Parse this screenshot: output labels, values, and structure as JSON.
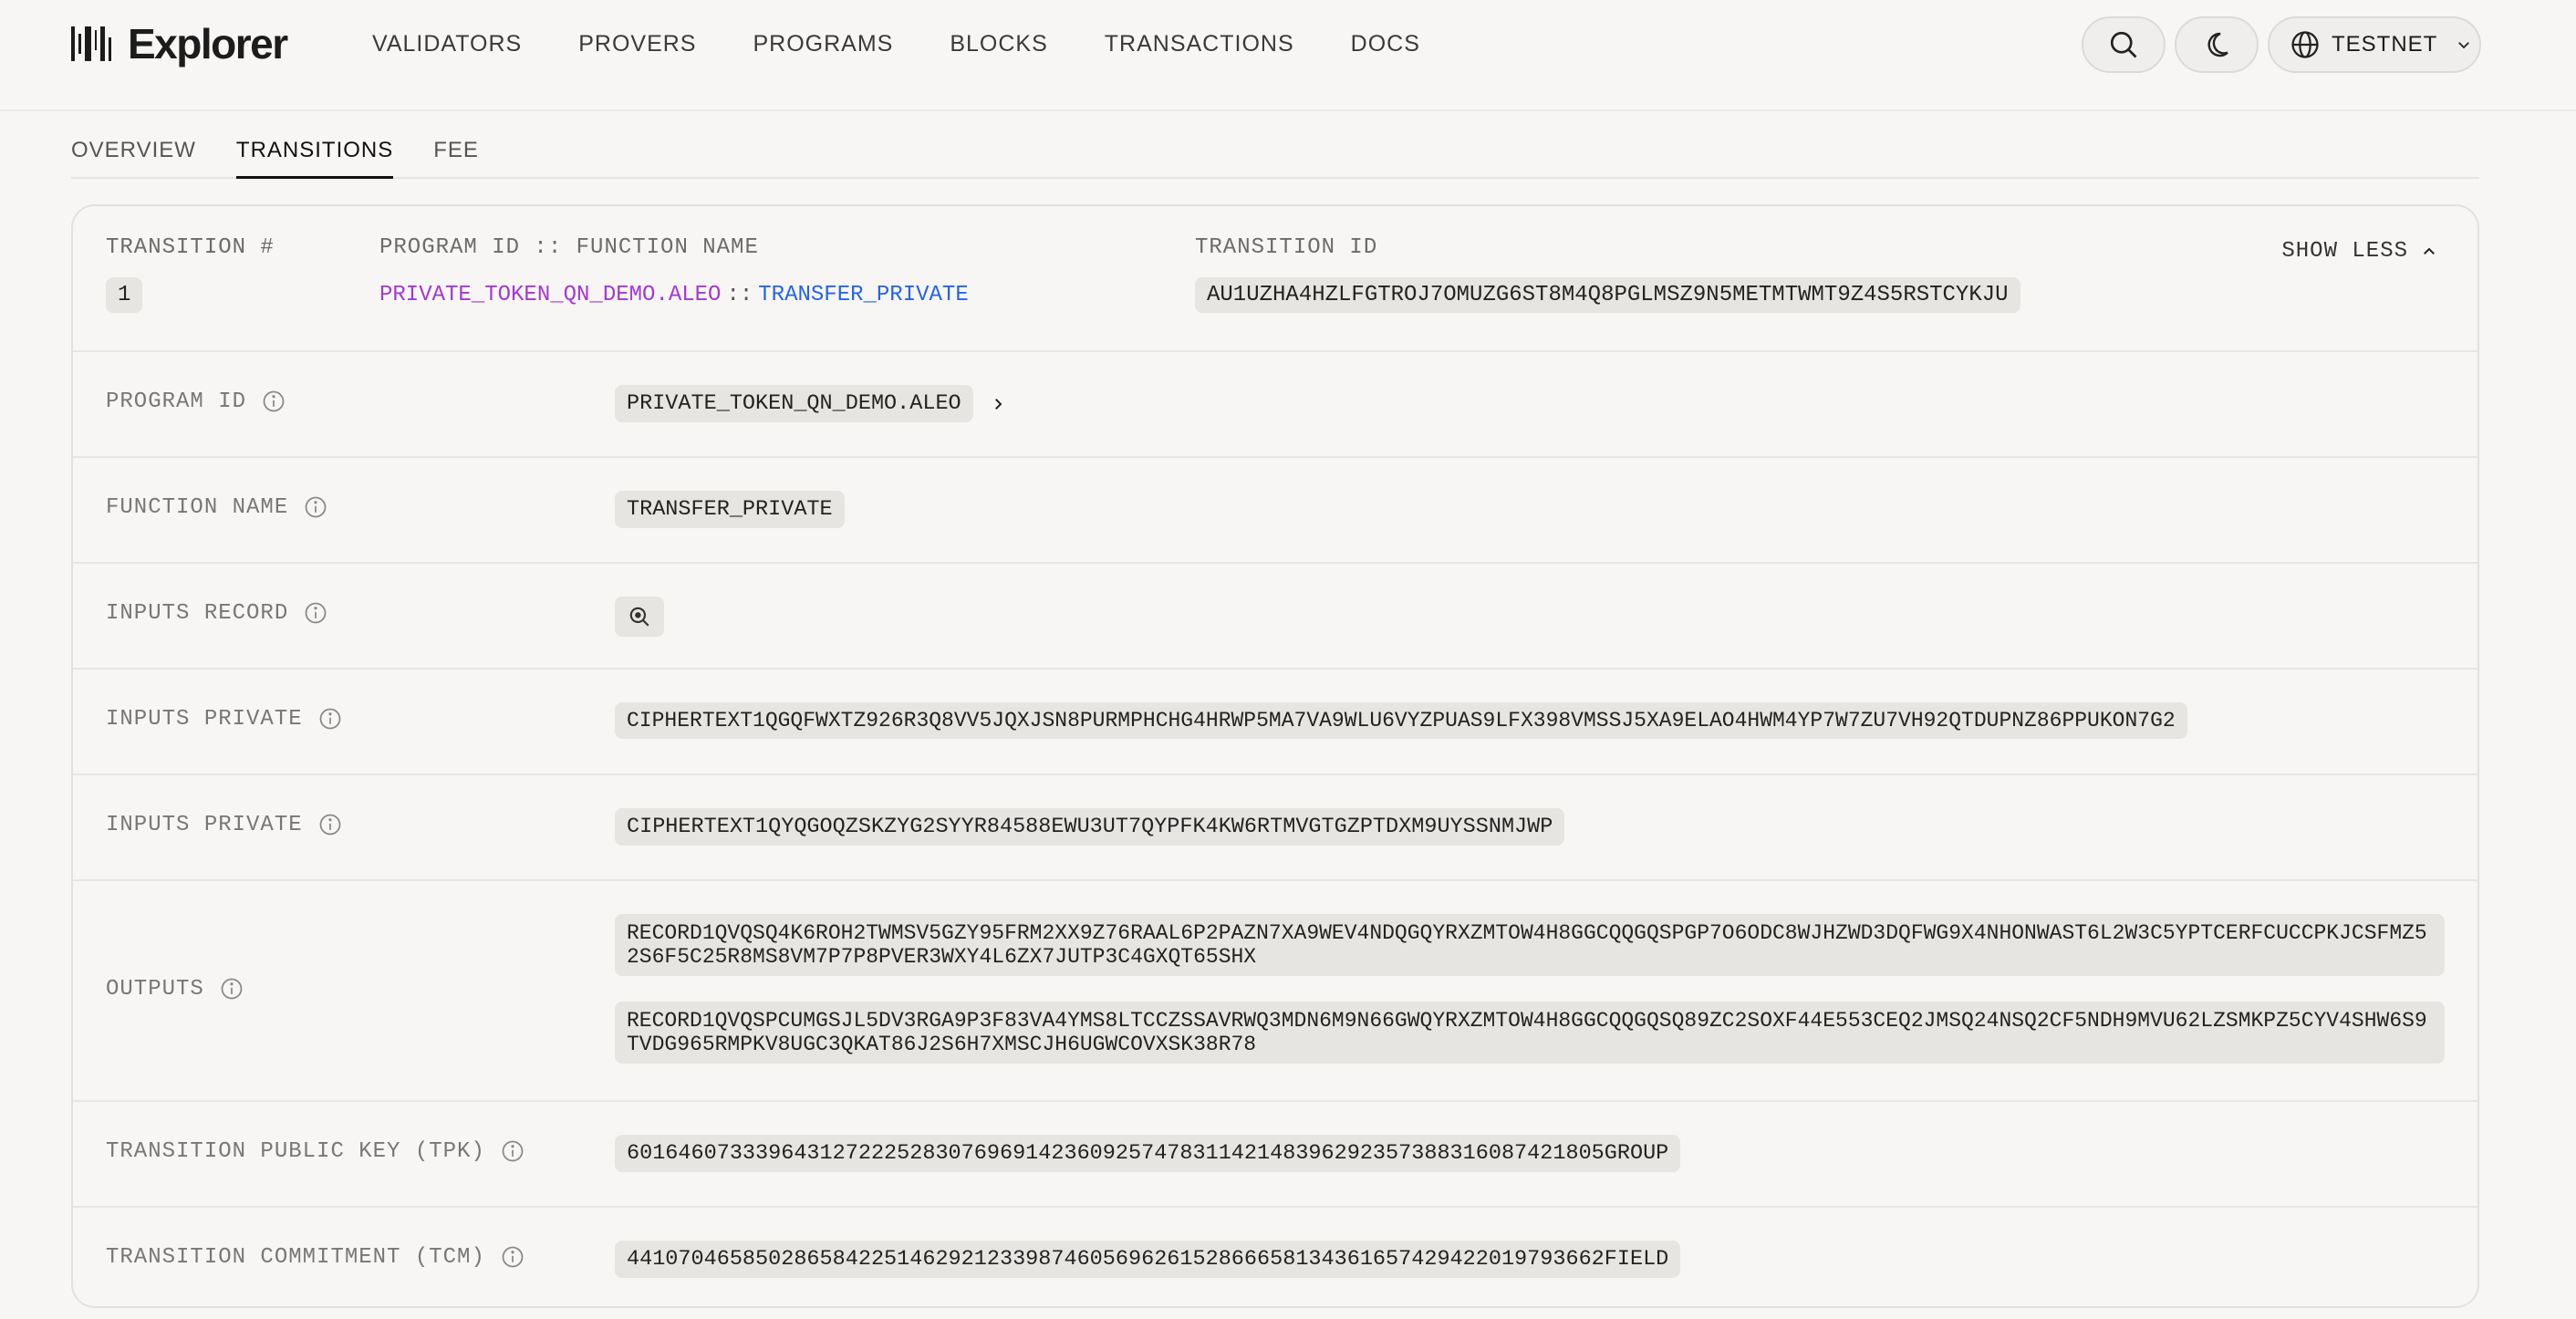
{
  "header": {
    "logo_text": "Explorer",
    "nav": [
      "VALIDATORS",
      "PROVERS",
      "PROGRAMS",
      "BLOCKS",
      "TRANSACTIONS",
      "DOCS"
    ],
    "network_label": "TESTNET"
  },
  "tabs": [
    "OVERVIEW",
    "TRANSITIONS",
    "FEE"
  ],
  "active_tab": "TRANSITIONS",
  "transition": {
    "headers": {
      "number": "TRANSITION #",
      "program_function": "PROGRAM ID :: FUNCTION NAME",
      "transition_id": "TRANSITION ID"
    },
    "number": "1",
    "program_id": "PRIVATE_TOKEN_QN_DEMO.ALEO",
    "separator": "::",
    "function_name": "TRANSFER_PRIVATE",
    "transition_id": "AU1UZHA4HZLFGTROJ7OMUZG6ST8M4Q8PGLMSZ9N5METMTWMT9Z4S5RSTCYKJU",
    "show_less": "SHOW LESS"
  },
  "details": {
    "program_id": {
      "label": "PROGRAM ID",
      "value": "PRIVATE_TOKEN_QN_DEMO.ALEO"
    },
    "function_name": {
      "label": "FUNCTION NAME",
      "value": "TRANSFER_PRIVATE"
    },
    "inputs_record": {
      "label": "INPUTS RECORD"
    },
    "inputs_private_1": {
      "label": "INPUTS PRIVATE",
      "value": "CIPHERTEXT1QGQFWXTZ926R3Q8VV5JQXJSN8PURMPHCHG4HRWP5MA7VA9WLU6VYZPUAS9LFX398VMSSJ5XA9ELAO4HWM4YP7W7ZU7VH92QTDUPNZ86PPUKON7G2"
    },
    "inputs_private_2": {
      "label": "INPUTS PRIVATE",
      "value": "CIPHERTEXT1QYQGOQZSKZYG2SYYR84588EWU3UT7QYPFK4KW6RTMVGTGZPTDXM9UYSSNMJWP"
    },
    "outputs": {
      "label": "OUTPUTS",
      "values": [
        "RECORD1QVQSQ4K6ROH2TWMSV5GZY95FRM2XX9Z76RAAL6P2PAZN7XA9WEV4NDQGQYRXZMTOW4H8GGCQQGQSPGP7O6ODC8WJHZWD3DQFWG9X4NHONWAST6L2W3C5YPTCERFCUCCPKJCSFMZ52S6F5C25R8MS8VM7P7P8PVER3WXY4L6ZX7JUTP3C4GXQT65SHX",
        "RECORD1QVQSPCUMGSJL5DV3RGA9P3F83VA4YMS8LTCCZSSAVRWQ3MDN6M9N66GWQYRXZMTOW4H8GGCQQGQSQ89ZC2SOXF44E553CEQ2JMSQ24NSQ2CF5NDH9MVU62LZSMKPZ5CYV4SHW6S9TVDG965RMPKV8UGC3QKAT86J2S6H7XMSCJH6UGWCOVXSK38R78"
      ]
    },
    "tpk": {
      "label": "TRANSITION PUBLIC KEY (TPK)",
      "value": "6016460733396431272225283076969142360925747831142148396292357388316087421805GROUP"
    },
    "tcm": {
      "label": "TRANSITION COMMITMENT (TCM)",
      "value": "4410704658502865842251462921233987460569626152866658134361657429422019793662FIELD"
    }
  }
}
